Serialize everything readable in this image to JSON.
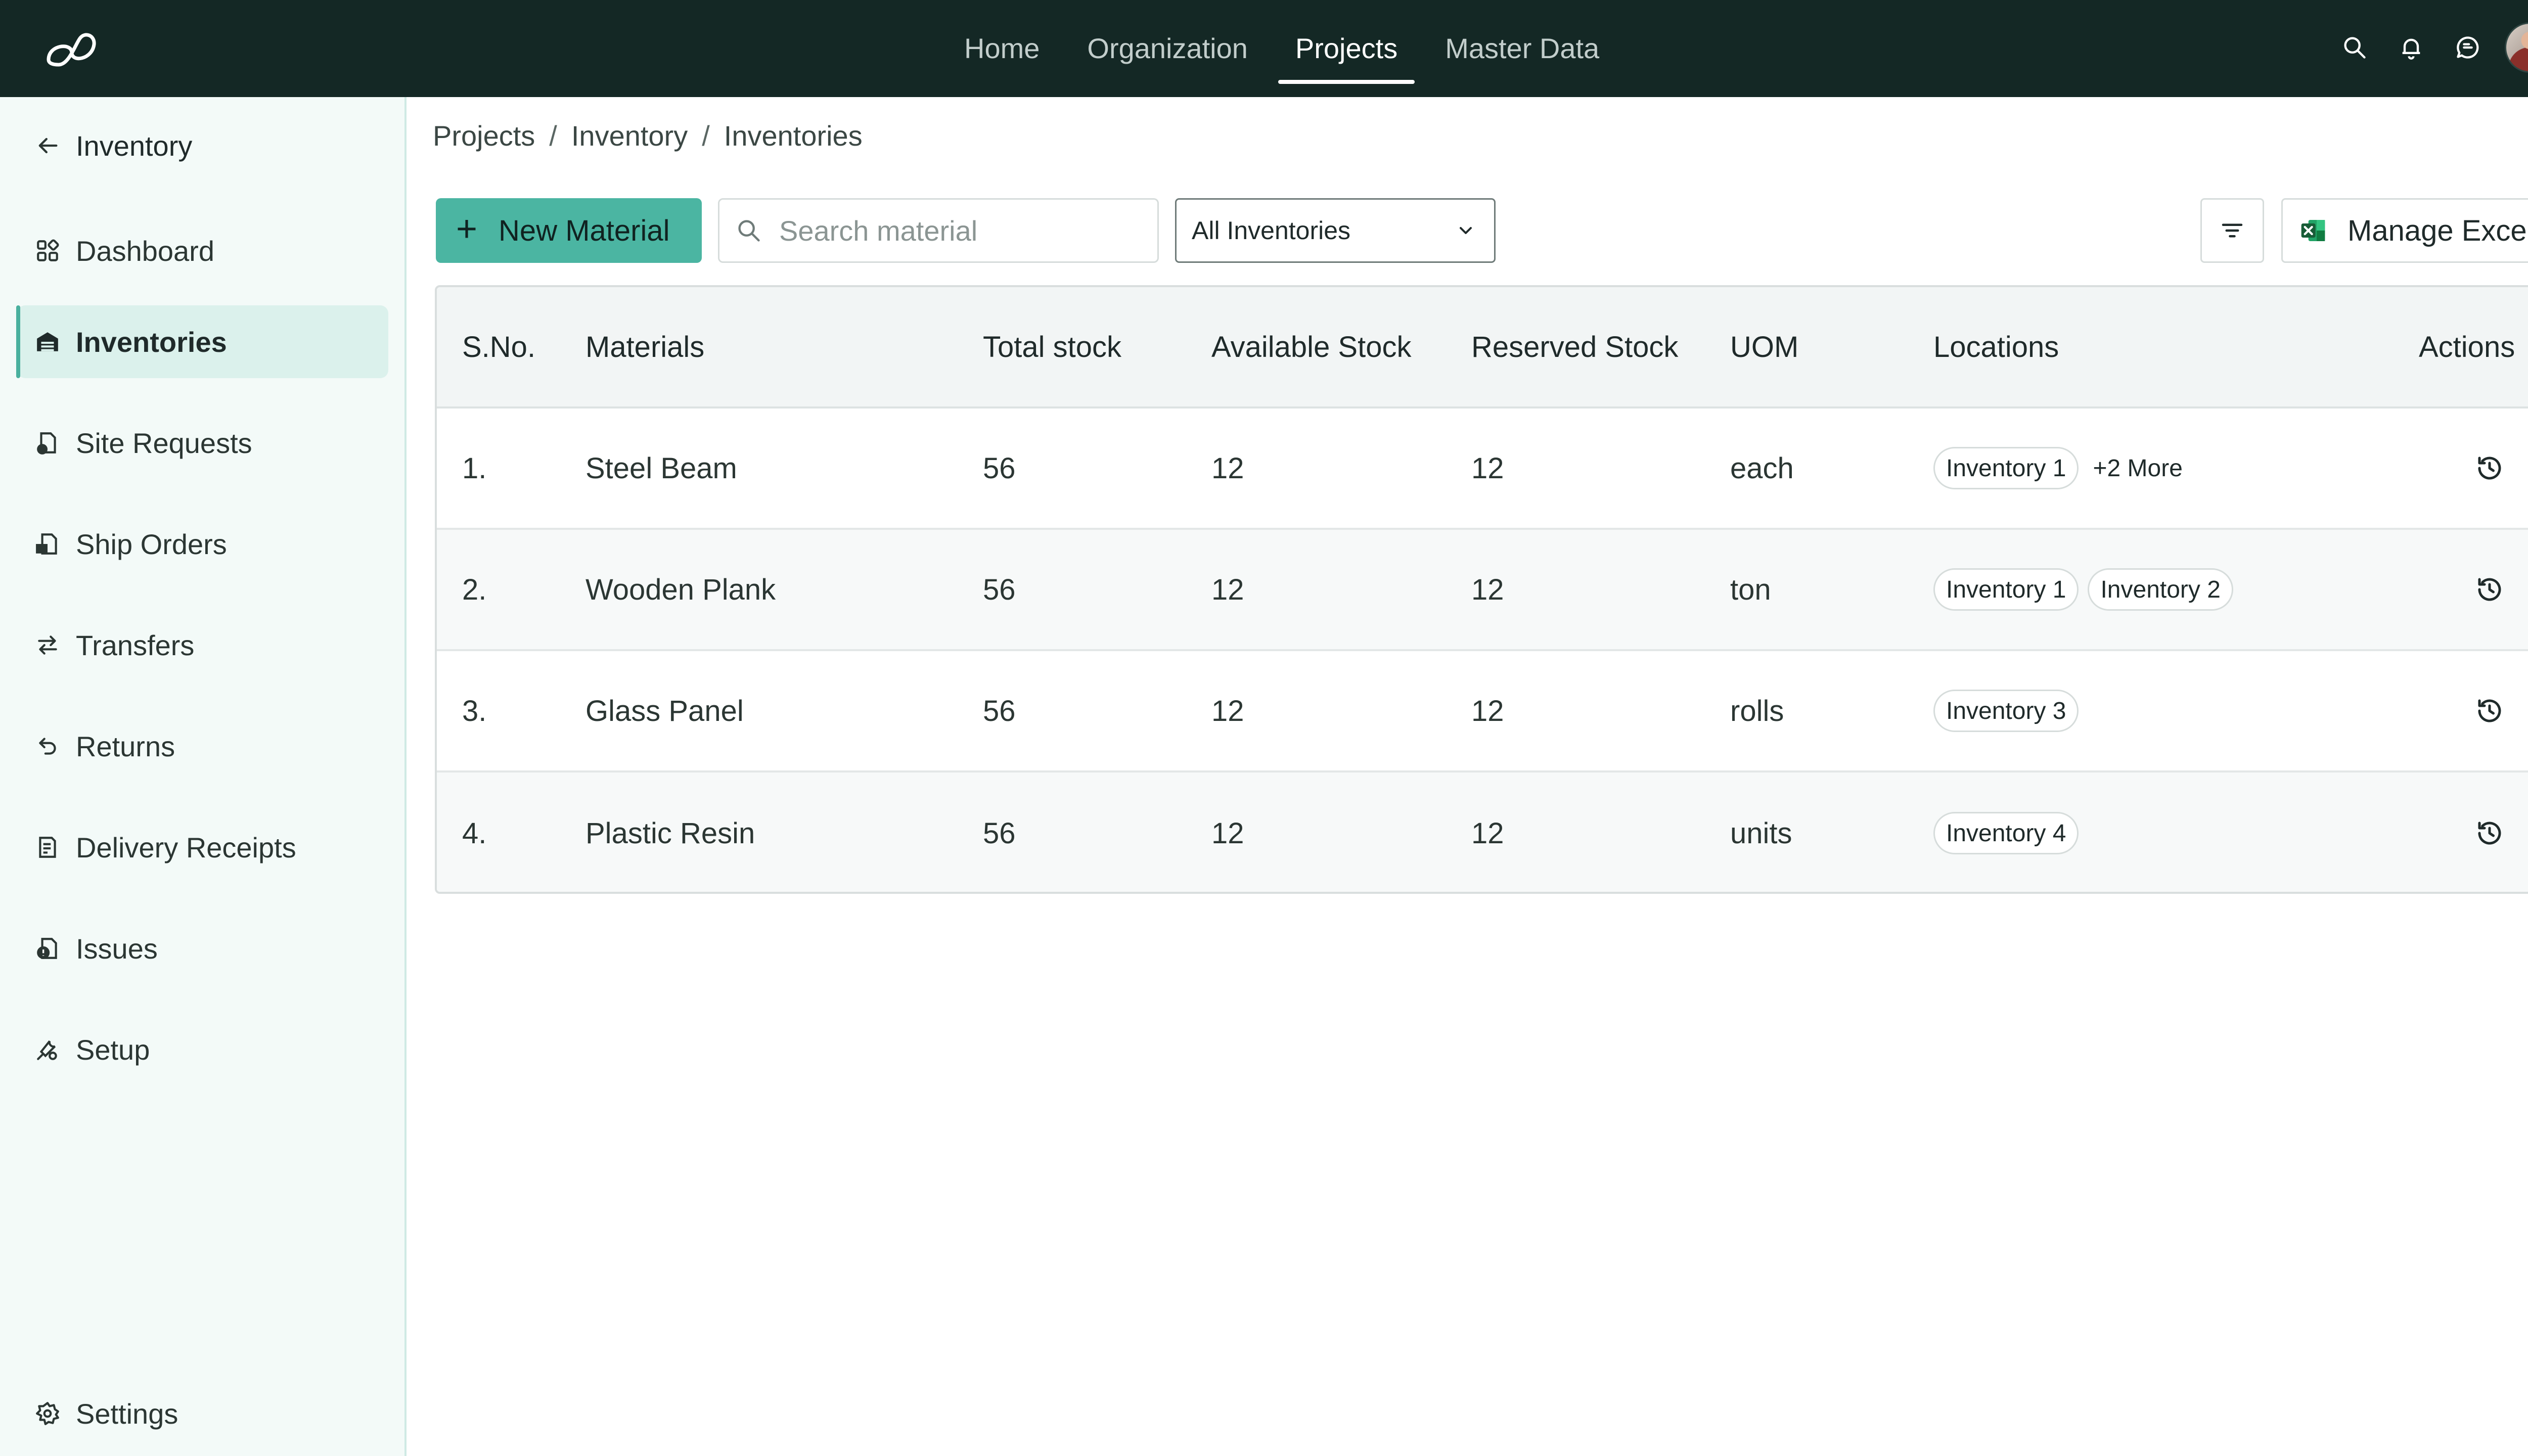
{
  "topnav": {
    "items": [
      {
        "label": "Home",
        "active": false
      },
      {
        "label": "Organization",
        "active": false
      },
      {
        "label": "Projects",
        "active": true
      },
      {
        "label": "Master Data",
        "active": false
      }
    ]
  },
  "sidebar": {
    "back_label": "Inventory",
    "items": [
      {
        "label": "Dashboard",
        "icon": "dashboard-icon"
      },
      {
        "label": "Inventories",
        "icon": "warehouse-icon",
        "active": true
      },
      {
        "label": "Site Requests",
        "icon": "site-request-icon"
      },
      {
        "label": "Ship Orders",
        "icon": "ship-order-icon"
      },
      {
        "label": "Transfers",
        "icon": "transfer-icon"
      },
      {
        "label": "Returns",
        "icon": "return-icon"
      },
      {
        "label": "Delivery Receipts",
        "icon": "receipt-icon"
      },
      {
        "label": "Issues",
        "icon": "issue-icon"
      },
      {
        "label": "Setup",
        "icon": "setup-icon"
      }
    ],
    "settings_label": "Settings"
  },
  "breadcrumb": {
    "items": [
      "Projects",
      "Inventory",
      "Inventories"
    ],
    "separator": "/"
  },
  "toolbar": {
    "new_label": "New Material",
    "search_placeholder": "Search material",
    "search_value": "",
    "select_value": "All Inventories",
    "excel_label": "Manage Excel"
  },
  "table": {
    "headers": {
      "sno": "S.No.",
      "materials": "Materials",
      "total": "Total stock",
      "available": "Available Stock",
      "reserved": "Reserved Stock",
      "uom": "UOM",
      "locations": "Locations",
      "actions": "Actions"
    },
    "rows": [
      {
        "sno": "1.",
        "material": "Steel Beam",
        "total": "56",
        "available": "12",
        "reserved": "12",
        "uom": "each",
        "locations": [
          "Inventory 1"
        ],
        "more": "+2 More"
      },
      {
        "sno": "2.",
        "material": "Wooden Plank",
        "total": "56",
        "available": "12",
        "reserved": "12",
        "uom": "ton",
        "locations": [
          "Inventory 1",
          "Inventory 2"
        ],
        "more": ""
      },
      {
        "sno": "3.",
        "material": "Glass Panel",
        "total": "56",
        "available": "12",
        "reserved": "12",
        "uom": "rolls",
        "locations": [
          "Inventory 3"
        ],
        "more": ""
      },
      {
        "sno": "4.",
        "material": "Plastic Resin",
        "total": "56",
        "available": "12",
        "reserved": "12",
        "uom": "units",
        "locations": [
          "Inventory 4"
        ],
        "more": ""
      }
    ]
  },
  "colors": {
    "topbar": "#142825",
    "accent": "#4bb5a2",
    "sidebar_bg": "#f3faf8",
    "sidebar_active": "#dbf1ec"
  }
}
